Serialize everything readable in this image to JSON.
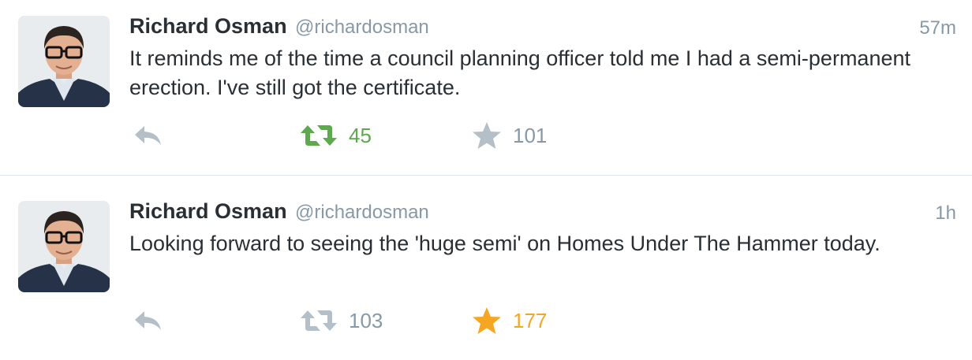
{
  "colors": {
    "retweet_active": "#5ea84e",
    "favorite_active": "#f5a623",
    "inactive": "#b4bfc8",
    "secondary_text": "#8899a6",
    "primary_text": "#292f33",
    "divider": "#e1e8ed"
  },
  "tweets": [
    {
      "name": "Richard Osman",
      "handle": "@richardosman",
      "time": "57m",
      "text": "It reminds me of the time a council planning officer told me I had a semi-permanent erection. I've still got the certificate.",
      "reply_icon": "reply-icon",
      "retweet_icon": "retweet-icon",
      "retweet_count": "45",
      "retweet_active": true,
      "favorite_icon": "star-icon",
      "favorite_count": "101",
      "favorite_active": false
    },
    {
      "name": "Richard Osman",
      "handle": "@richardosman",
      "time": "1h",
      "text": "Looking forward to seeing the 'huge semi' on Homes Under The Hammer today.",
      "reply_icon": "reply-icon",
      "retweet_icon": "retweet-icon",
      "retweet_count": "103",
      "retweet_active": false,
      "favorite_icon": "star-icon",
      "favorite_count": "177",
      "favorite_active": true
    }
  ]
}
